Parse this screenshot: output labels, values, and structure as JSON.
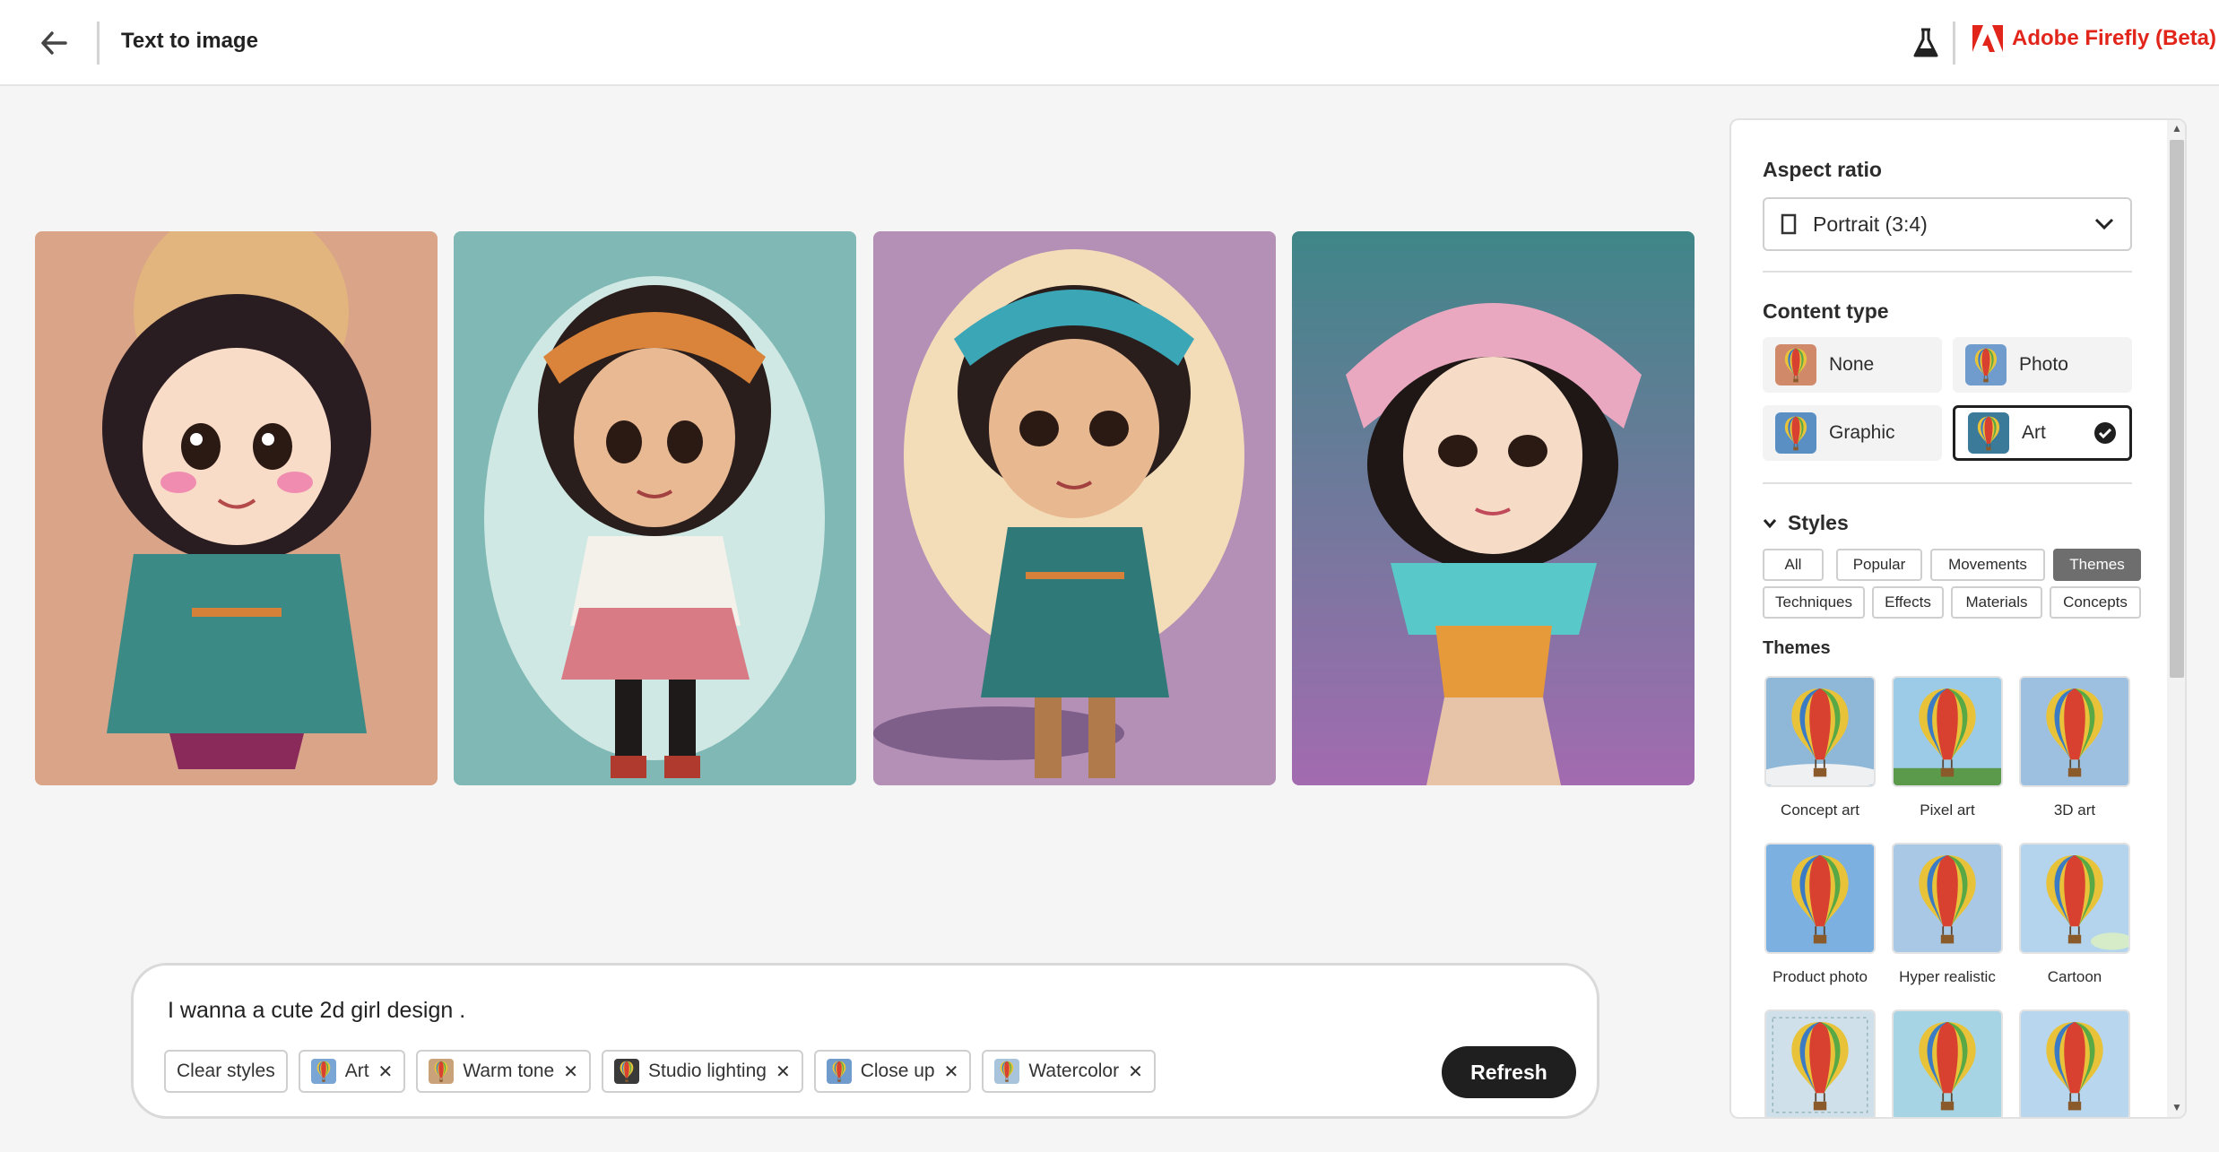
{
  "header": {
    "title": "Text to image",
    "brand": "Adobe Firefly (Beta)",
    "icons": [
      "arrow-left-icon",
      "flask-icon",
      "adobe-logo-icon"
    ]
  },
  "images": [
    {
      "name": "girl-1",
      "background": "#d9a488"
    },
    {
      "name": "girl-2",
      "background": "#7fb8b4"
    },
    {
      "name": "girl-3",
      "background": "#b490b6"
    },
    {
      "name": "girl-4",
      "background": "#4f8e90"
    }
  ],
  "prompt": {
    "text": "I wanna a cute 2d girl design .",
    "clear_label": "Clear styles",
    "chips": [
      {
        "label": "Art"
      },
      {
        "label": "Warm tone"
      },
      {
        "label": "Studio lighting"
      },
      {
        "label": "Close up"
      },
      {
        "label": "Watercolor"
      }
    ],
    "refresh_label": "Refresh"
  },
  "panel": {
    "aspect_label": "Aspect ratio",
    "aspect_value": "Portrait (3:4)",
    "content_type_label": "Content type",
    "content_types": [
      {
        "label": "None",
        "selected": false
      },
      {
        "label": "Photo",
        "selected": false
      },
      {
        "label": "Graphic",
        "selected": false
      },
      {
        "label": "Art",
        "selected": true
      }
    ],
    "styles_label": "Styles",
    "style_tabs": [
      "All",
      "Popular",
      "Movements",
      "Themes",
      "Techniques",
      "Effects",
      "Materials",
      "Concepts"
    ],
    "active_tab": "Themes",
    "themes_label": "Themes",
    "themes": [
      "Concept art",
      "Pixel art",
      "3D art",
      "Product photo",
      "Hyper realistic",
      "Cartoon",
      "",
      "",
      ""
    ]
  },
  "colors": {
    "brand_red": "#e1251b",
    "dark_button": "#1f1f1f",
    "active_tab": "#6e6e6e"
  }
}
